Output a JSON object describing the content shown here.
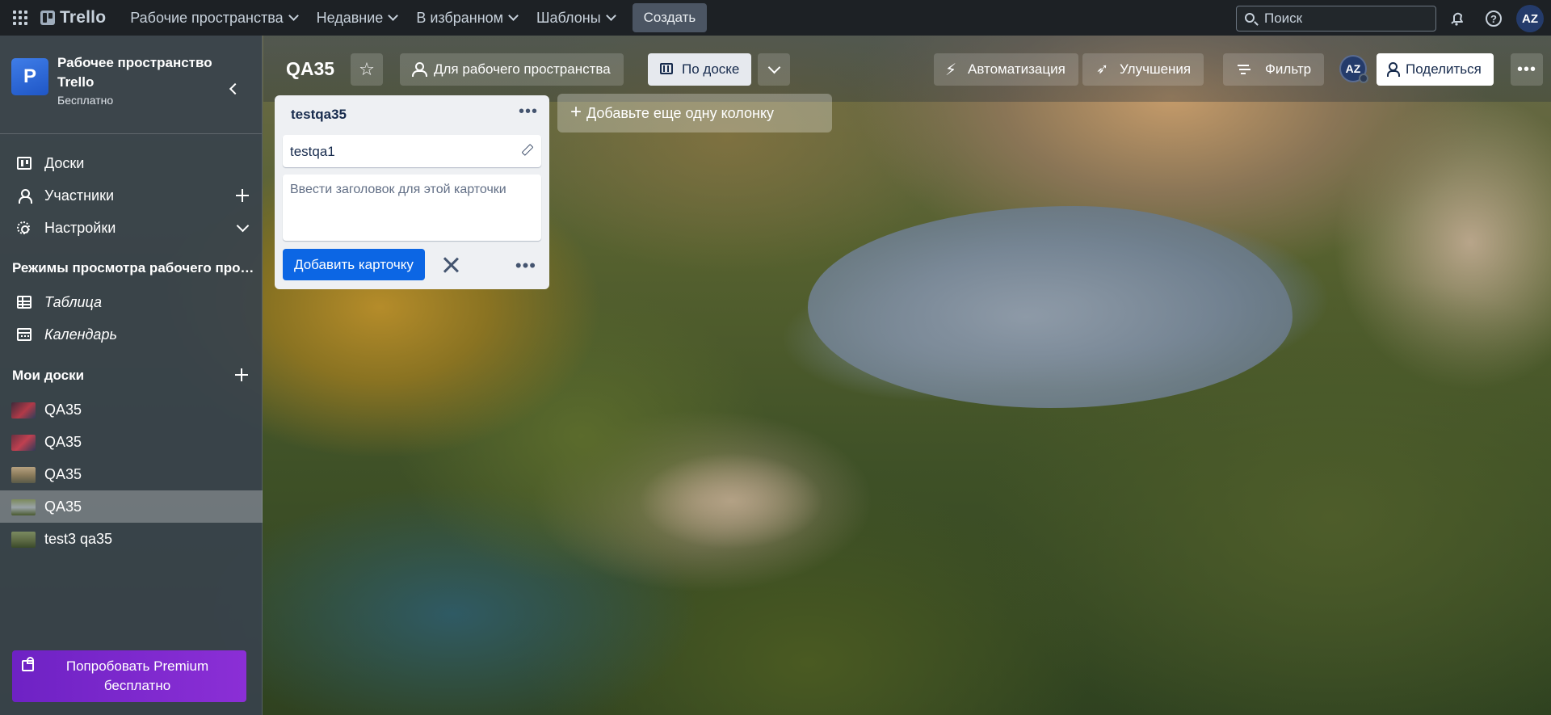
{
  "topnav": {
    "logo": "Trello",
    "menus": [
      {
        "label": "Рабочие пространства"
      },
      {
        "label": "Недавние"
      },
      {
        "label": "В избранном"
      },
      {
        "label": "Шаблоны"
      }
    ],
    "create_label": "Создать",
    "search_placeholder": "Поиск",
    "avatar_initials": "AZ"
  },
  "sidebar": {
    "workspace_initial": "P",
    "workspace_name": "Рабочее пространство Trello",
    "workspace_plan": "Бесплатно",
    "nav": [
      {
        "label": "Доски",
        "icon": "board-icon"
      },
      {
        "label": "Участники",
        "icon": "user-icon"
      },
      {
        "label": "Настройки",
        "icon": "gear-icon"
      }
    ],
    "views_heading": "Режимы просмотра рабочего пространства",
    "views": [
      {
        "label": "Таблица",
        "icon": "table-icon"
      },
      {
        "label": "Календарь",
        "icon": "calendar-icon"
      }
    ],
    "boards_heading": "Мои доски",
    "boards": [
      {
        "label": "QA35",
        "active": false
      },
      {
        "label": "QA35",
        "active": false
      },
      {
        "label": "QA35",
        "active": false
      },
      {
        "label": "QA35",
        "active": true
      },
      {
        "label": "test3 qa35",
        "active": false
      }
    ],
    "premium_label": "Попробовать Premium бесплатно"
  },
  "board": {
    "title": "QA35",
    "visibility_label": "Для рабочего пространства",
    "view_label": "По доске",
    "automation_label": "Автоматизация",
    "powerups_label": "Улучшения",
    "filter_label": "Фильтр",
    "member_initials": "AZ",
    "share_label": "Поделиться"
  },
  "list": {
    "title": "testqa35",
    "cards": [
      {
        "title": "testqa1"
      }
    ],
    "composer_placeholder": "Ввести заголовок для этой карточки",
    "add_card_label": "Добавить карточку"
  },
  "add_list_label": "Добавьте еще одну колонку",
  "colors": {
    "topnav_bg": "#1d2125",
    "accent_blue": "#0c66e4",
    "premium_purple": "#7a29cc",
    "workspace_badge": "#2f6ee0"
  }
}
